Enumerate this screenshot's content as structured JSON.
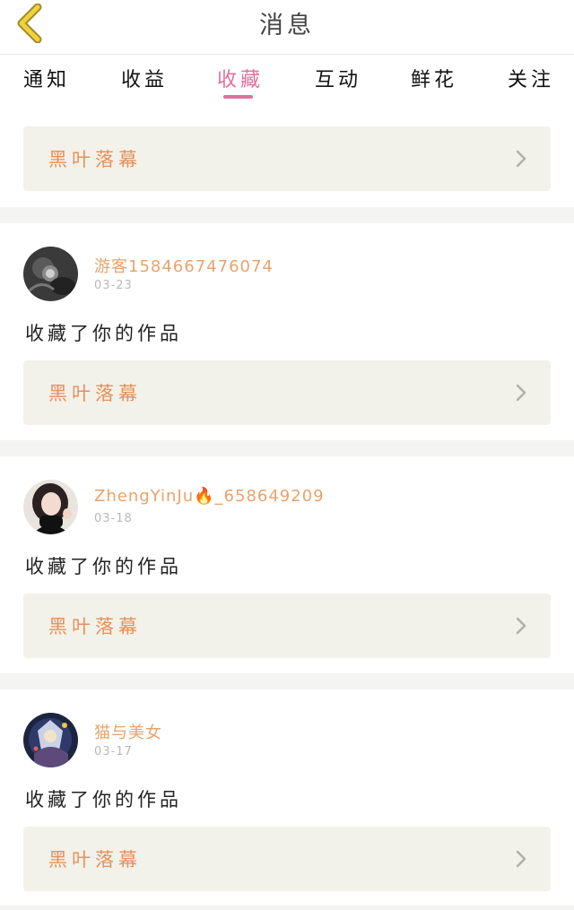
{
  "header": {
    "title": "消息",
    "back_icon": "chevron-left-icon",
    "back_icon_color": "#f0d23a"
  },
  "tabs": [
    {
      "label": "通知",
      "active": false
    },
    {
      "label": "收益",
      "active": false
    },
    {
      "label": "收藏",
      "active": true
    },
    {
      "label": "互动",
      "active": false
    },
    {
      "label": "鲜花",
      "active": false
    },
    {
      "label": "关注",
      "active": false
    }
  ],
  "colors": {
    "accent": "#e2709c",
    "work_title": "#e6905a",
    "username": "#e8a36b",
    "card_bg": "#f2f2ea",
    "date": "#b8b8b8"
  },
  "top_work": {
    "title": "黑叶落幕",
    "chevron_icon": "chevron-right-icon"
  },
  "messages": [
    {
      "avatar_icon": "avatar-dark-photo",
      "username": "游客1584667476074",
      "date": "03-23",
      "action": "收藏了你的作品",
      "work_title": "黑叶落幕"
    },
    {
      "avatar_icon": "avatar-girl-photo",
      "username": "ZhengYinJu🔥_658649209",
      "date": "03-18",
      "action": "收藏了你的作品",
      "work_title": "黑叶落幕"
    },
    {
      "avatar_icon": "avatar-anime-photo",
      "username": "猫与美女",
      "date": "03-17",
      "action": "收藏了你的作品",
      "work_title": "黑叶落幕"
    }
  ]
}
